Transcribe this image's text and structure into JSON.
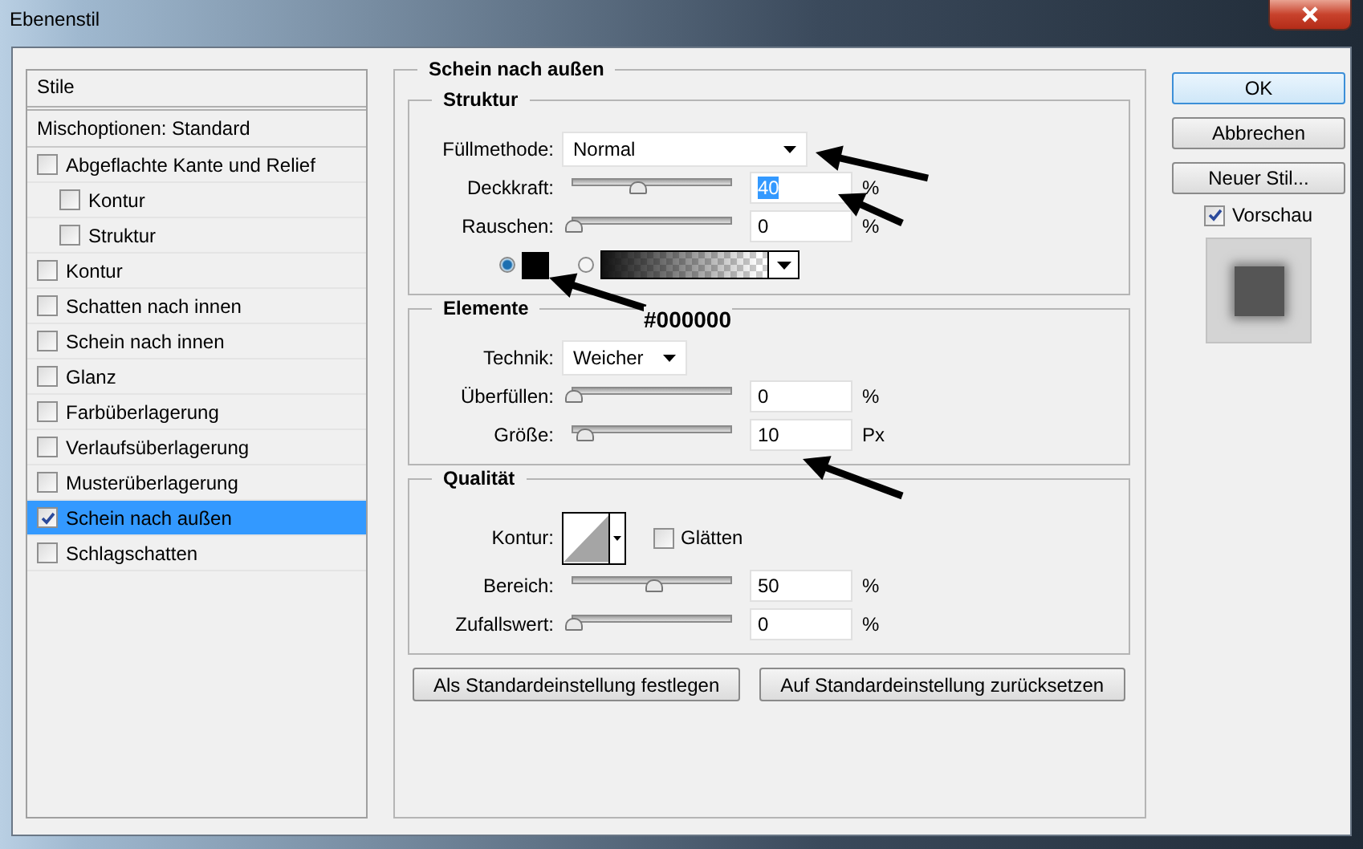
{
  "window": {
    "title": "Ebenenstil"
  },
  "styles_panel": {
    "header": "Stile",
    "blend_options": "Mischoptionen: Standard",
    "items": [
      {
        "label": "Abgeflachte Kante und Relief",
        "checked": false,
        "selected": false,
        "children": [
          {
            "label": "Kontur",
            "checked": false,
            "selected": false
          },
          {
            "label": "Struktur",
            "checked": false,
            "selected": false
          }
        ]
      },
      {
        "label": "Kontur",
        "checked": false,
        "selected": false
      },
      {
        "label": "Schatten nach innen",
        "checked": false,
        "selected": false
      },
      {
        "label": "Schein nach innen",
        "checked": false,
        "selected": false
      },
      {
        "label": "Glanz",
        "checked": false,
        "selected": false
      },
      {
        "label": "Farbüberlagerung",
        "checked": false,
        "selected": false
      },
      {
        "label": "Verlaufsüberlagerung",
        "checked": false,
        "selected": false
      },
      {
        "label": "Musterüberlagerung",
        "checked": false,
        "selected": false
      },
      {
        "label": "Schein nach außen",
        "checked": true,
        "selected": true
      },
      {
        "label": "Schlagschatten",
        "checked": false,
        "selected": false
      }
    ]
  },
  "settings": {
    "title": "Schein nach außen",
    "structure": {
      "title": "Struktur",
      "blend_mode": {
        "label": "Füllmethode:",
        "value": "Normal"
      },
      "sliders": [
        {
          "label": "Deckkraft:",
          "level": 0.4,
          "value": "40",
          "unit": "%",
          "text_selected": true
        },
        {
          "label": "Rauschen:",
          "level": 0,
          "value": "0",
          "unit": "%",
          "text_selected": false
        }
      ],
      "fill_options": [
        {
          "kind": "color",
          "selected": true,
          "color": "#000000"
        },
        {
          "kind": "gradient",
          "selected": false
        }
      ]
    },
    "elements": {
      "title": "Elemente",
      "technique": {
        "label": "Technik:",
        "value": "Weicher"
      },
      "sliders": [
        {
          "label": "Überfüllen:",
          "level": 0,
          "value": "0",
          "unit": "%",
          "text_selected": false
        },
        {
          "label": "Größe:",
          "level": 0.07,
          "value": "10",
          "unit": "Px",
          "text_selected": false
        }
      ]
    },
    "quality": {
      "title": "Qualität",
      "contour": {
        "label": "Kontur:"
      },
      "anti_alias": {
        "label": "Glätten",
        "checked": false
      },
      "sliders": [
        {
          "label": "Bereich:",
          "level": 0.5,
          "value": "50",
          "unit": "%",
          "text_selected": false
        },
        {
          "label": "Zufallswert:",
          "level": 0,
          "value": "0",
          "unit": "%",
          "text_selected": false
        }
      ]
    },
    "default_buttons": [
      "Als Standardeinstellung festlegen",
      "Auf Standardeinstellung zurücksetzen"
    ]
  },
  "buttons": [
    {
      "label": "OK",
      "default": true
    },
    {
      "label": "Abbrechen",
      "default": false
    },
    {
      "label": "Neuer Stil...",
      "default": false
    }
  ],
  "preview": {
    "label": "Vorschau",
    "checked": true
  },
  "annotation": {
    "text": "#000000"
  }
}
